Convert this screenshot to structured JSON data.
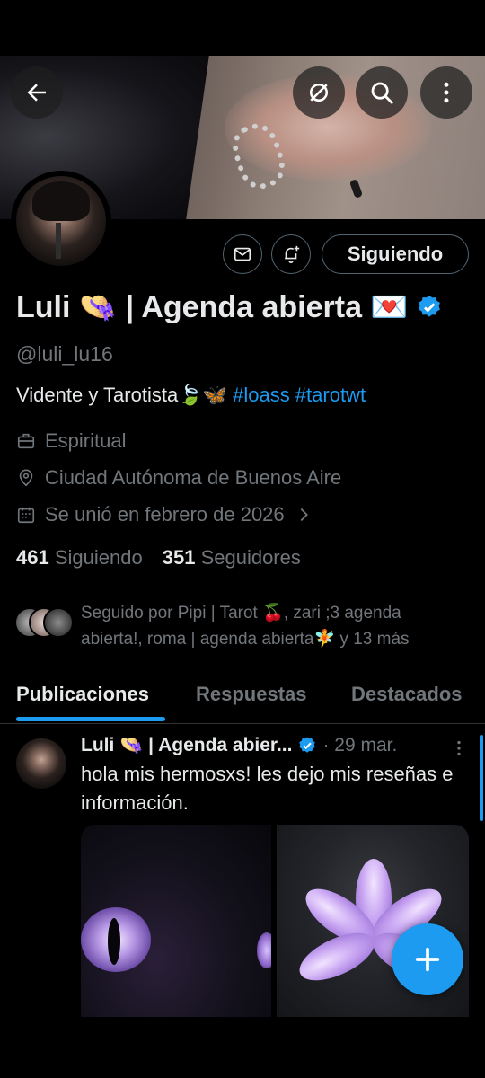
{
  "profile": {
    "display_name": "Luli 👒 | Agenda abierta 💌",
    "handle": "@luli_lu16",
    "bio_text": "Vidente y Tarotista🍃🦋 ",
    "bio_tags": "#loass #tarotwt",
    "category": "Espiritual",
    "location": "Ciudad Autónoma de Buenos Aire",
    "joined": "Se unió en febrero de 2026",
    "following_count": "461",
    "following_label": "Siguiendo",
    "followers_count": "351",
    "followers_label": "Seguidores",
    "followed_by": "Seguido por Pipi | Tarot 🍒, zari ;3 agenda abierta!, roma | agenda abierta🧚 y 13 más"
  },
  "actions": {
    "follow_state_label": "Siguiendo"
  },
  "tabs": [
    "Publicaciones",
    "Respuestas",
    "Destacados"
  ],
  "post": {
    "author": "Luli 👒 | Agenda abier...",
    "date": "· 29 mar.",
    "text": "hola mis hermosxs! les dejo mis reseñas e información."
  },
  "colors": {
    "accent": "#1d9bf0",
    "secondary_text": "#71767b",
    "background": "#000000",
    "border": "#2f3336"
  },
  "icons": [
    "back-arrow-icon",
    "grok-icon",
    "search-icon",
    "more-vertical-icon",
    "mail-icon",
    "bell-plus-icon",
    "verified-badge-icon",
    "briefcase-icon",
    "location-pin-icon",
    "calendar-icon",
    "chevron-right-icon",
    "plus-icon"
  ]
}
